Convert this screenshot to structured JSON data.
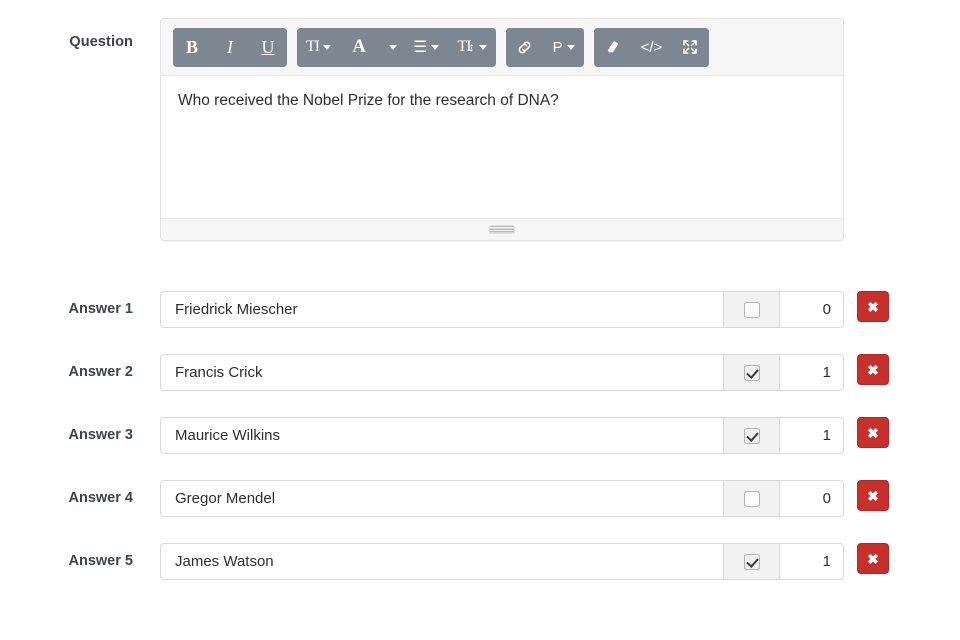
{
  "question": {
    "label": "Question",
    "body_text": "Who received the Nobel Prize for the research of DNA?",
    "toolbar": {
      "groups": [
        {
          "name": "text-style-group",
          "buttons": [
            {
              "name": "bold-icon",
              "glyph": "B",
              "label": "Bold"
            },
            {
              "name": "italic-icon",
              "glyph": "I",
              "label": "Italic"
            },
            {
              "name": "underline-icon",
              "glyph": "U",
              "label": "Underline"
            }
          ]
        },
        {
          "name": "format-group",
          "buttons": [
            {
              "name": "font-size-icon",
              "glyph": "TI",
              "label": "Font size"
            },
            {
              "name": "text-color-icon",
              "glyph": "A",
              "label": "Text color"
            },
            {
              "name": "color-picker-caret-icon",
              "glyph": "",
              "label": "Color picker"
            },
            {
              "name": "alignment-icon",
              "glyph": "☰",
              "label": "Alignment"
            },
            {
              "name": "line-height-icon",
              "glyph": "TI",
              "label": "Line height"
            }
          ]
        },
        {
          "name": "insert-group",
          "buttons": [
            {
              "name": "link-icon",
              "glyph": "🔗",
              "label": "Insert link"
            },
            {
              "name": "paragraph-format-icon",
              "glyph": "P",
              "label": "Paragraph format"
            }
          ]
        },
        {
          "name": "tools-group",
          "buttons": [
            {
              "name": "eraser-icon",
              "glyph": "◧",
              "label": "Clear formatting"
            },
            {
              "name": "source-code-icon",
              "glyph": "</>",
              "label": "HTML source"
            },
            {
              "name": "fullscreen-icon",
              "glyph": "⤢",
              "label": "Fullscreen"
            }
          ]
        }
      ]
    }
  },
  "answers": [
    {
      "label": "Answer 1",
      "text": "Friedrick Miescher",
      "checked": false,
      "grade": "0",
      "delete_label": "✖"
    },
    {
      "label": "Answer 2",
      "text": "Francis Crick",
      "checked": true,
      "grade": "1",
      "delete_label": "✖"
    },
    {
      "label": "Answer 3",
      "text": "Maurice Wilkins",
      "checked": true,
      "grade": "1",
      "delete_label": "✖"
    },
    {
      "label": "Answer 4",
      "text": "Gregor Mendel",
      "checked": false,
      "grade": "0",
      "delete_label": "✖"
    },
    {
      "label": "Answer 5",
      "text": "James Watson",
      "checked": true,
      "grade": "1",
      "delete_label": "✖"
    }
  ],
  "colors": {
    "toolbar_button_bg": "#7c8792",
    "delete_button_bg": "#c9302c",
    "editor_chrome_bg": "#f6f6f6",
    "label_text": "#3c444c",
    "addon_bg": "#f2f2f2"
  }
}
